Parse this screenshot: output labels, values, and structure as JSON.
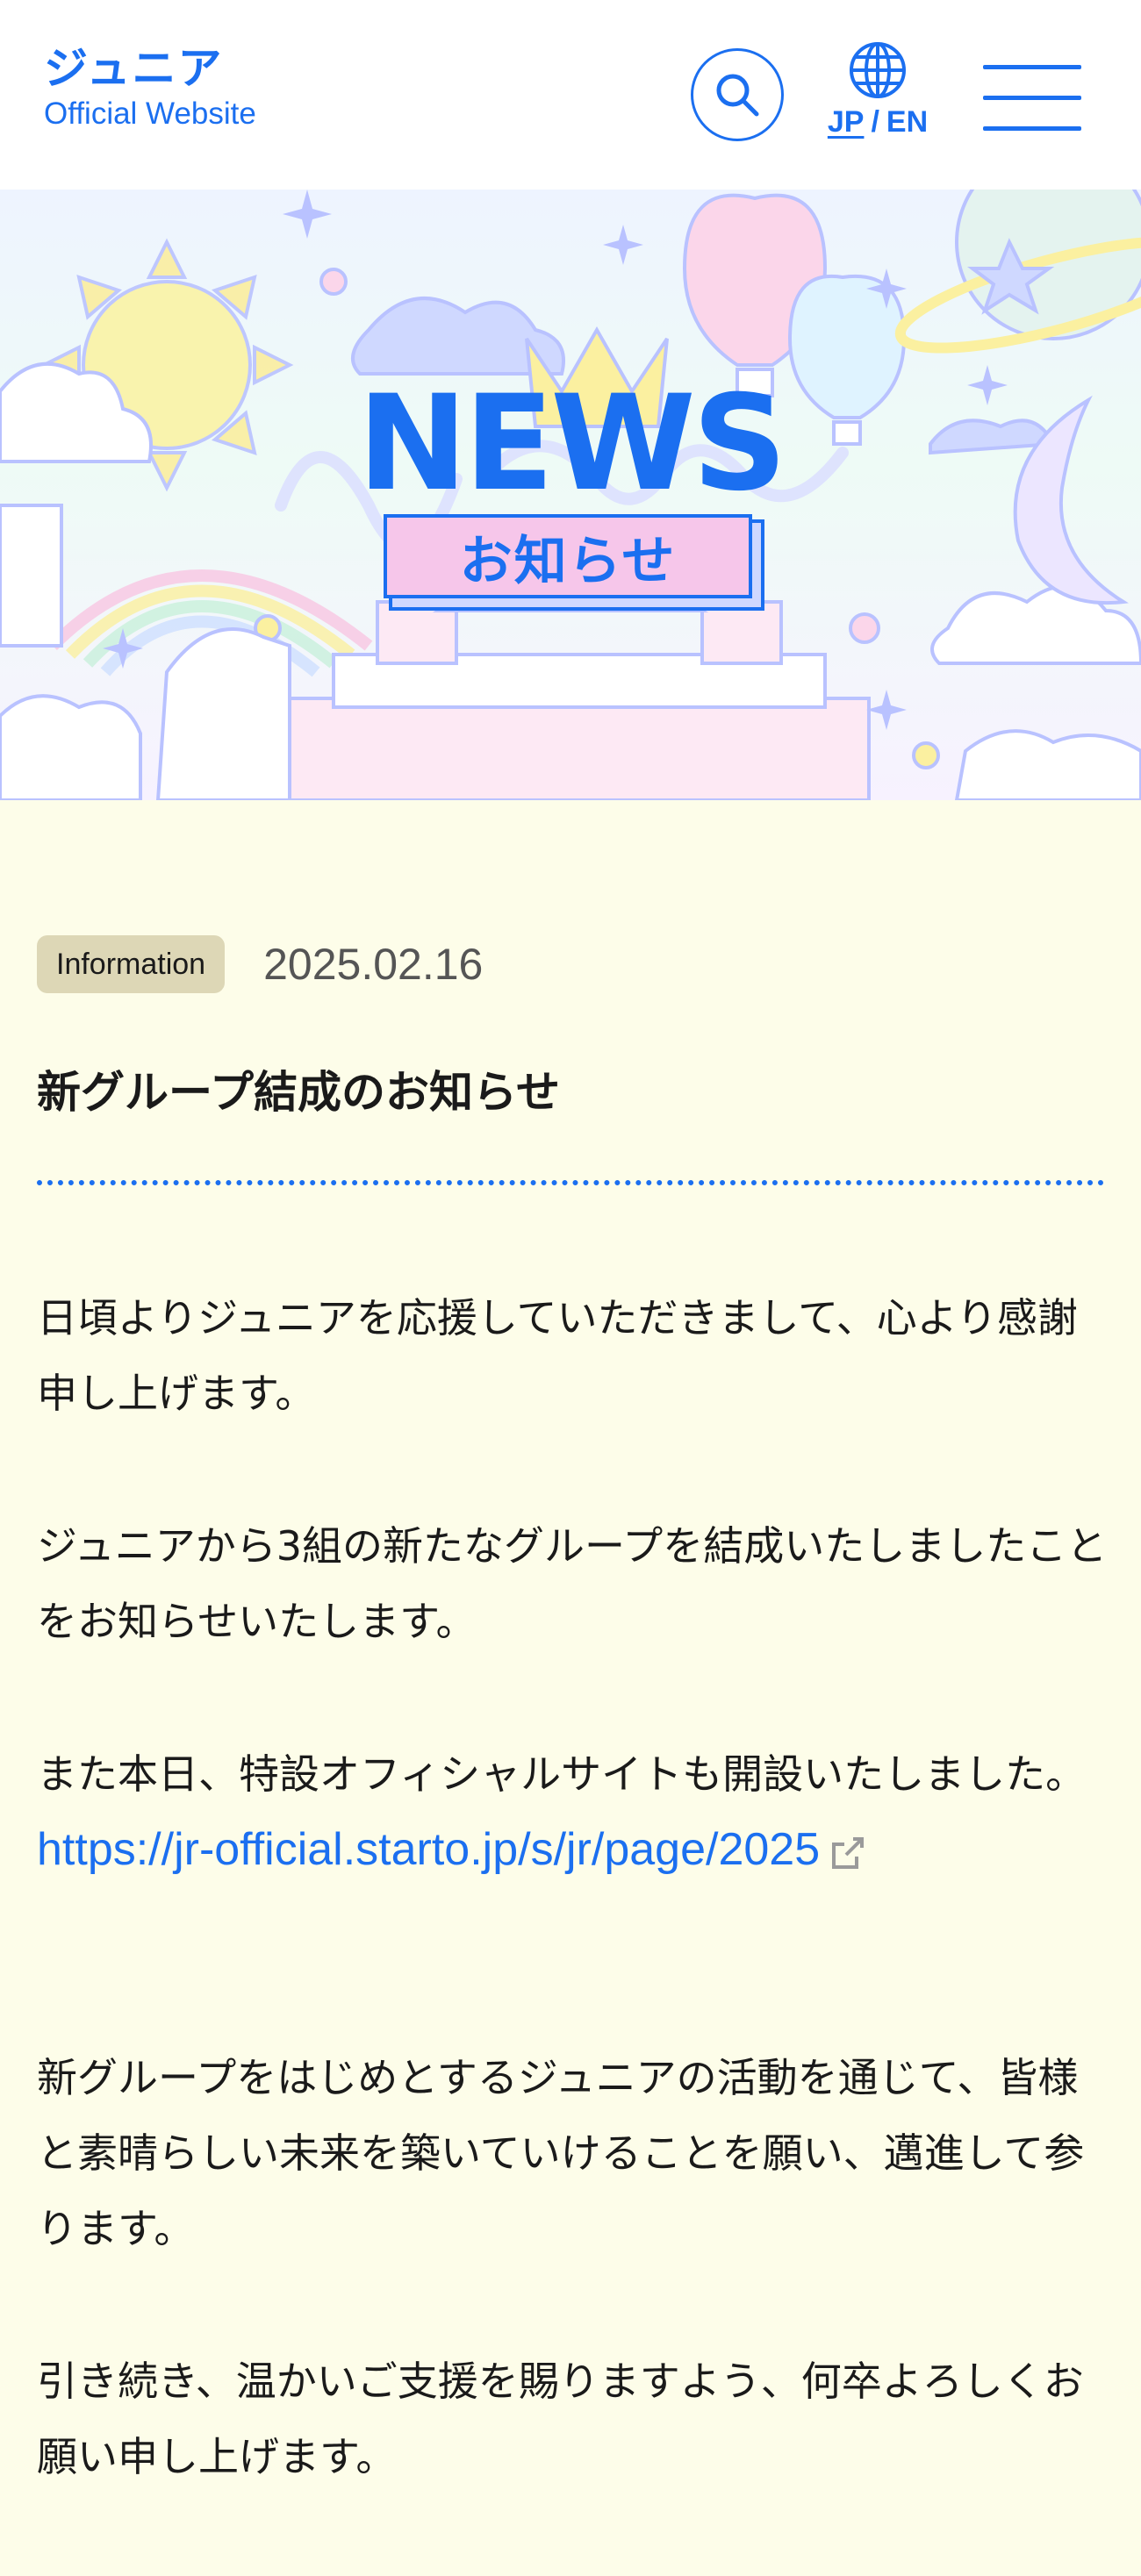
{
  "header": {
    "logo_main": "ジュニア",
    "logo_sub": "Official Website",
    "search_icon": "search-icon",
    "globe_icon": "globe-icon",
    "lang_jp": "JP",
    "lang_separator": "/",
    "lang_en": "EN",
    "menu_icon": "hamburger-menu-icon",
    "accent_color": "#1b6ff0"
  },
  "hero": {
    "title": "NEWS",
    "subtitle": "お知らせ"
  },
  "article": {
    "category": "Information",
    "date": "2025.02.16",
    "title": "新グループ結成のお知らせ",
    "paragraphs": [
      "日頃よりジュニアを応援していただきまして、心より感謝申し上げます。",
      "ジュニアから3組の新たなグループを結成いたしましたことをお知らせいたします。",
      "また本日、特設オフィシャルサイトも開設いたしました。",
      "新グループをはじめとするジュニアの活動を通じて、皆様と素晴らしい未来を築いていけることを願い、邁進して参ります。",
      "引き続き、温かいご支援を賜りますよう、何卒よろしくお願い申し上げます。"
    ],
    "link_text": "https://jr-official.starto.jp/s/jr/page/2025",
    "external_link_icon": "external-link-icon"
  }
}
